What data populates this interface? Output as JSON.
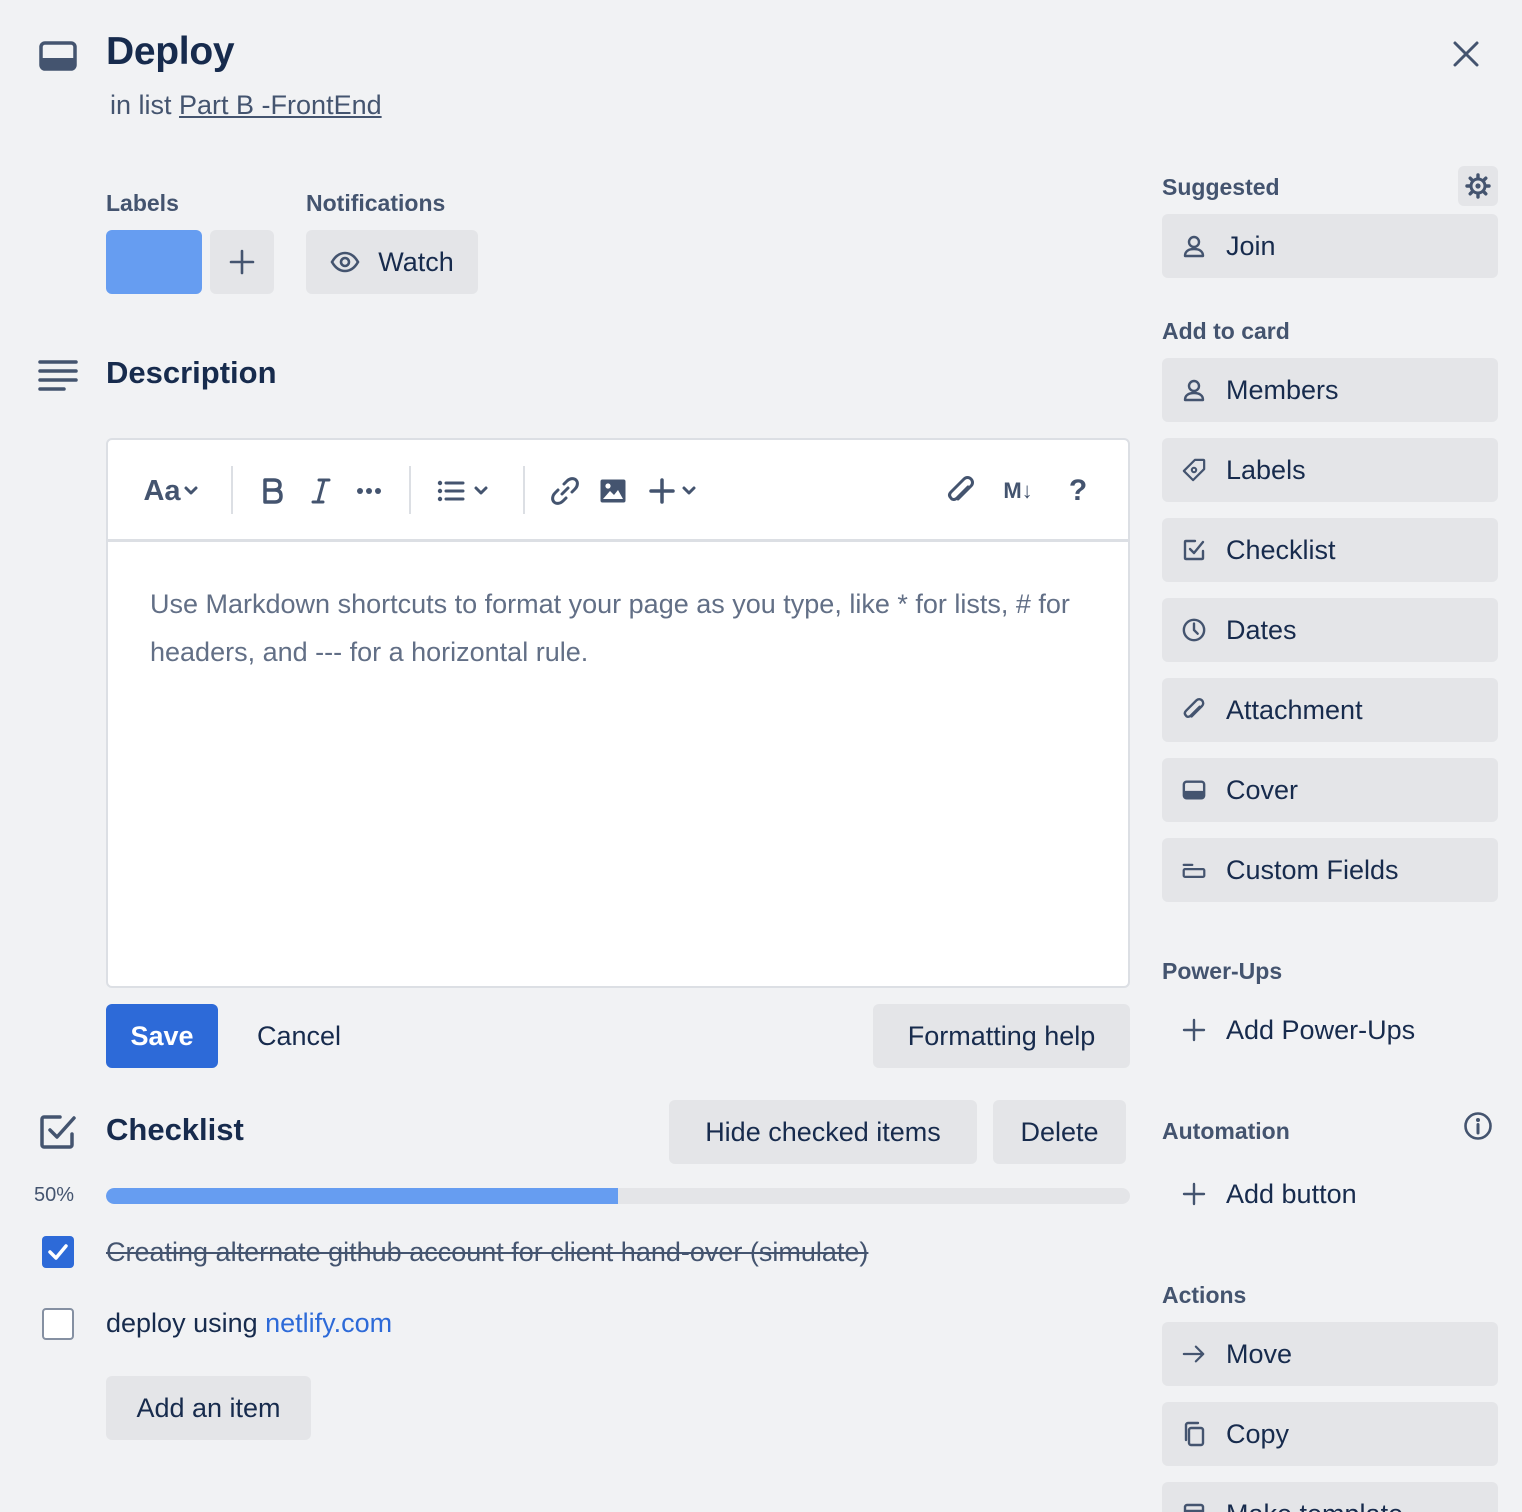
{
  "header": {
    "title": "Deploy",
    "in_list_prefix": "in list",
    "list_name": "Part B -FrontEnd"
  },
  "labels_section": {
    "heading": "Labels",
    "label_color": "#669df1"
  },
  "notifications_section": {
    "heading": "Notifications",
    "watch_label": "Watch"
  },
  "description": {
    "heading": "Description",
    "toolbar": {
      "text_style": "Aa",
      "markdown": "M↓",
      "help": "?"
    },
    "placeholder": "Use Markdown shortcuts to format your page as you type, like * for lists, # for headers, and --- for a horizontal rule.",
    "save_label": "Save",
    "cancel_label": "Cancel",
    "formatting_help_label": "Formatting help"
  },
  "checklist": {
    "heading": "Checklist",
    "hide_checked_label": "Hide checked items",
    "delete_label": "Delete",
    "progress_text": "50%",
    "progress_fraction": 0.5,
    "items": [
      {
        "text": "Creating alternate github account for client hand-over (simulate)",
        "checked": true
      },
      {
        "text_prefix": "deploy using ",
        "link_text": "netlify.com",
        "checked": false
      }
    ],
    "add_item_label": "Add an item"
  },
  "sidebar": {
    "suggested": {
      "heading": "Suggested",
      "join_label": "Join"
    },
    "add_to_card": {
      "heading": "Add to card",
      "items": [
        {
          "label": "Members",
          "icon": "person-icon"
        },
        {
          "label": "Labels",
          "icon": "tag-icon"
        },
        {
          "label": "Checklist",
          "icon": "checkbox-icon"
        },
        {
          "label": "Dates",
          "icon": "clock-icon"
        },
        {
          "label": "Attachment",
          "icon": "paperclip-icon"
        },
        {
          "label": "Cover",
          "icon": "cover-icon"
        },
        {
          "label": "Custom Fields",
          "icon": "custom-fields-icon"
        }
      ]
    },
    "power_ups": {
      "heading": "Power-Ups",
      "add_label": "Add Power-Ups"
    },
    "automation": {
      "heading": "Automation",
      "add_button_label": "Add button"
    },
    "actions": {
      "heading": "Actions",
      "items": [
        {
          "label": "Move",
          "icon": "arrow-right-icon"
        },
        {
          "label": "Copy",
          "icon": "copy-icon"
        },
        {
          "label": "Make template",
          "icon": "template-icon"
        }
      ]
    }
  },
  "colors": {
    "primary": "#2d6ad8",
    "label_blue": "#669df1",
    "background": "#f1f2f4",
    "button_grey": "#e4e5e8",
    "text": "#172b4d"
  }
}
